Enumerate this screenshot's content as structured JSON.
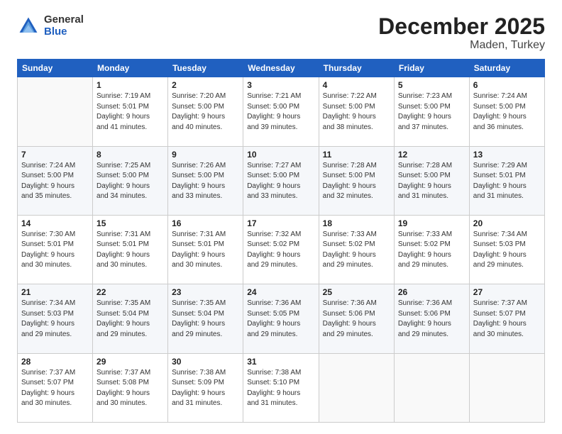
{
  "logo": {
    "general": "General",
    "blue": "Blue"
  },
  "title": {
    "month": "December 2025",
    "location": "Maden, Turkey"
  },
  "calendar": {
    "headers": [
      "Sunday",
      "Monday",
      "Tuesday",
      "Wednesday",
      "Thursday",
      "Friday",
      "Saturday"
    ],
    "rows": [
      [
        {
          "day": "",
          "info": ""
        },
        {
          "day": "1",
          "info": "Sunrise: 7:19 AM\nSunset: 5:01 PM\nDaylight: 9 hours\nand 41 minutes."
        },
        {
          "day": "2",
          "info": "Sunrise: 7:20 AM\nSunset: 5:00 PM\nDaylight: 9 hours\nand 40 minutes."
        },
        {
          "day": "3",
          "info": "Sunrise: 7:21 AM\nSunset: 5:00 PM\nDaylight: 9 hours\nand 39 minutes."
        },
        {
          "day": "4",
          "info": "Sunrise: 7:22 AM\nSunset: 5:00 PM\nDaylight: 9 hours\nand 38 minutes."
        },
        {
          "day": "5",
          "info": "Sunrise: 7:23 AM\nSunset: 5:00 PM\nDaylight: 9 hours\nand 37 minutes."
        },
        {
          "day": "6",
          "info": "Sunrise: 7:24 AM\nSunset: 5:00 PM\nDaylight: 9 hours\nand 36 minutes."
        }
      ],
      [
        {
          "day": "7",
          "info": "Sunrise: 7:24 AM\nSunset: 5:00 PM\nDaylight: 9 hours\nand 35 minutes."
        },
        {
          "day": "8",
          "info": "Sunrise: 7:25 AM\nSunset: 5:00 PM\nDaylight: 9 hours\nand 34 minutes."
        },
        {
          "day": "9",
          "info": "Sunrise: 7:26 AM\nSunset: 5:00 PM\nDaylight: 9 hours\nand 33 minutes."
        },
        {
          "day": "10",
          "info": "Sunrise: 7:27 AM\nSunset: 5:00 PM\nDaylight: 9 hours\nand 33 minutes."
        },
        {
          "day": "11",
          "info": "Sunrise: 7:28 AM\nSunset: 5:00 PM\nDaylight: 9 hours\nand 32 minutes."
        },
        {
          "day": "12",
          "info": "Sunrise: 7:28 AM\nSunset: 5:00 PM\nDaylight: 9 hours\nand 31 minutes."
        },
        {
          "day": "13",
          "info": "Sunrise: 7:29 AM\nSunset: 5:01 PM\nDaylight: 9 hours\nand 31 minutes."
        }
      ],
      [
        {
          "day": "14",
          "info": "Sunrise: 7:30 AM\nSunset: 5:01 PM\nDaylight: 9 hours\nand 30 minutes."
        },
        {
          "day": "15",
          "info": "Sunrise: 7:31 AM\nSunset: 5:01 PM\nDaylight: 9 hours\nand 30 minutes."
        },
        {
          "day": "16",
          "info": "Sunrise: 7:31 AM\nSunset: 5:01 PM\nDaylight: 9 hours\nand 30 minutes."
        },
        {
          "day": "17",
          "info": "Sunrise: 7:32 AM\nSunset: 5:02 PM\nDaylight: 9 hours\nand 29 minutes."
        },
        {
          "day": "18",
          "info": "Sunrise: 7:33 AM\nSunset: 5:02 PM\nDaylight: 9 hours\nand 29 minutes."
        },
        {
          "day": "19",
          "info": "Sunrise: 7:33 AM\nSunset: 5:02 PM\nDaylight: 9 hours\nand 29 minutes."
        },
        {
          "day": "20",
          "info": "Sunrise: 7:34 AM\nSunset: 5:03 PM\nDaylight: 9 hours\nand 29 minutes."
        }
      ],
      [
        {
          "day": "21",
          "info": "Sunrise: 7:34 AM\nSunset: 5:03 PM\nDaylight: 9 hours\nand 29 minutes."
        },
        {
          "day": "22",
          "info": "Sunrise: 7:35 AM\nSunset: 5:04 PM\nDaylight: 9 hours\nand 29 minutes."
        },
        {
          "day": "23",
          "info": "Sunrise: 7:35 AM\nSunset: 5:04 PM\nDaylight: 9 hours\nand 29 minutes."
        },
        {
          "day": "24",
          "info": "Sunrise: 7:36 AM\nSunset: 5:05 PM\nDaylight: 9 hours\nand 29 minutes."
        },
        {
          "day": "25",
          "info": "Sunrise: 7:36 AM\nSunset: 5:06 PM\nDaylight: 9 hours\nand 29 minutes."
        },
        {
          "day": "26",
          "info": "Sunrise: 7:36 AM\nSunset: 5:06 PM\nDaylight: 9 hours\nand 29 minutes."
        },
        {
          "day": "27",
          "info": "Sunrise: 7:37 AM\nSunset: 5:07 PM\nDaylight: 9 hours\nand 30 minutes."
        }
      ],
      [
        {
          "day": "28",
          "info": "Sunrise: 7:37 AM\nSunset: 5:07 PM\nDaylight: 9 hours\nand 30 minutes."
        },
        {
          "day": "29",
          "info": "Sunrise: 7:37 AM\nSunset: 5:08 PM\nDaylight: 9 hours\nand 30 minutes."
        },
        {
          "day": "30",
          "info": "Sunrise: 7:38 AM\nSunset: 5:09 PM\nDaylight: 9 hours\nand 31 minutes."
        },
        {
          "day": "31",
          "info": "Sunrise: 7:38 AM\nSunset: 5:10 PM\nDaylight: 9 hours\nand 31 minutes."
        },
        {
          "day": "",
          "info": ""
        },
        {
          "day": "",
          "info": ""
        },
        {
          "day": "",
          "info": ""
        }
      ]
    ]
  }
}
